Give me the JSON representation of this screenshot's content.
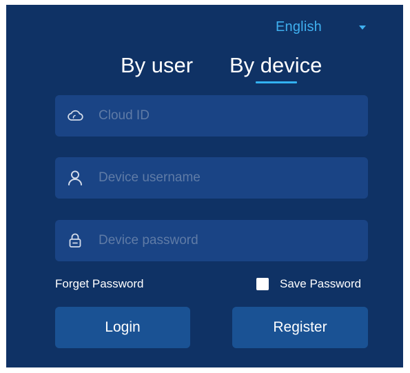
{
  "language": {
    "selected": "English",
    "icon": "chevron-down-icon"
  },
  "tabs": [
    {
      "label": "By user",
      "active": false
    },
    {
      "label": "By device",
      "active": true
    }
  ],
  "fields": {
    "cloud_id": {
      "placeholder": "Cloud ID",
      "value": "",
      "icon": "cloud-icon"
    },
    "device_username": {
      "placeholder": "Device username",
      "value": "",
      "icon": "user-icon"
    },
    "device_password": {
      "placeholder": "Device password",
      "value": "",
      "icon": "lock-icon"
    }
  },
  "links": {
    "forget_password": "Forget Password"
  },
  "save_password": {
    "label": "Save Password",
    "checked": false
  },
  "buttons": {
    "login": "Login",
    "register": "Register"
  },
  "colors": {
    "panel_background": "#0f3265",
    "field_background": "#1a4485",
    "button_background": "#1a5294",
    "accent": "#3fb0f0",
    "text": "#ffffff",
    "placeholder": "#5f7ba6"
  }
}
